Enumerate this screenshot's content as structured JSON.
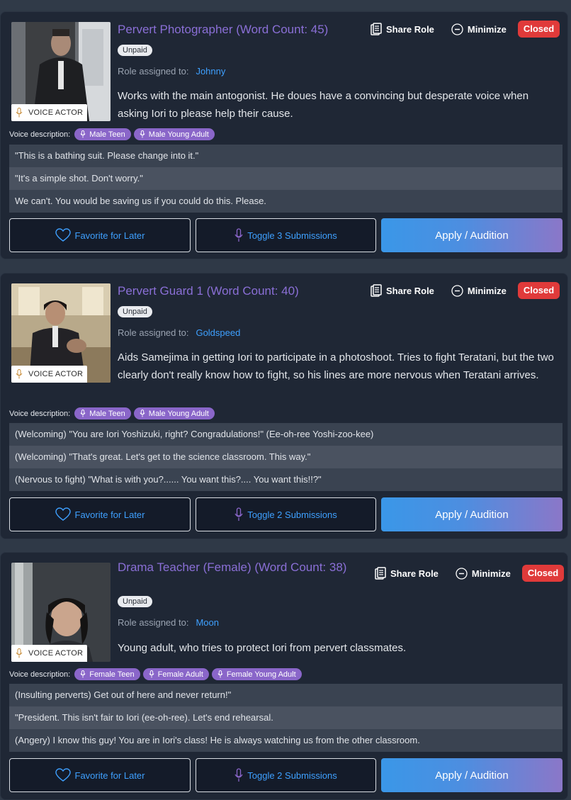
{
  "colors": {
    "title": "#8a6fd6",
    "link": "#3ea0ff",
    "closed": "#e03a3a",
    "tag": "#8a66c9"
  },
  "common": {
    "voice_actor": "VOICE ACTOR",
    "unpaid": "Unpaid",
    "role_assigned_label": "Role assigned to:",
    "voice_description_label": "Voice description:",
    "share": "Share Role",
    "minimize": "Minimize",
    "closed": "Closed",
    "favorite": "Favorite for Later",
    "apply": "Apply / Audition"
  },
  "roles": [
    {
      "title": "Pervert Photographer (Word Count: 45)",
      "assigned_to": "Johnny",
      "description": "Works with the main antogonist. He doues have a convincing but desperate voice when asking Iori to please help their cause.",
      "tags": [
        "Male Teen",
        "Male Young Adult"
      ],
      "lines": [
        "\"This is a bathing suit. Please change into it.\"",
        "\"It's a simple shot. Don't worry.\"",
        "We can't. You would be saving us if you could do this. Please."
      ],
      "toggle": "Toggle 3 Submissions"
    },
    {
      "title": "Pervert Guard 1 (Word Count: 40)",
      "assigned_to": "Goldspeed",
      "description": "Aids Samejima in getting Iori to participate in a photoshoot. Tries to fight Teratani, but the two clearly don't really know how to fight, so his lines are more nervous when Teratani arrives.",
      "tags": [
        "Male Teen",
        "Male Young Adult"
      ],
      "lines": [
        "(Welcoming) \"You are Iori Yoshizuki, right? Congradulations!\" (Ee-oh-ree Yoshi-zoo-kee)",
        "(Welcoming) \"That's great. Let's get to the science classroom. This way.\"",
        "(Nervous to fight) \"What is with you?...... You want this?.... You want this!!?\""
      ],
      "toggle": "Toggle 2 Submissions"
    },
    {
      "title": "Drama Teacher (Female) (Word Count: 38)",
      "assigned_to": "Moon",
      "description": "Young adult, who tries to protect Iori from pervert classmates.",
      "tags": [
        "Female Teen",
        "Female Adult",
        "Female Young Adult"
      ],
      "lines": [
        "(Insulting perverts) Get out of here and never return!\"",
        "\"President. This isn't fair to Iori (ee-oh-ree). Let's end rehearsal.",
        "(Angery) I know this guy! You are in Iori's class! He is always watching us from the other classroom."
      ],
      "toggle": "Toggle 2 Submissions"
    }
  ]
}
